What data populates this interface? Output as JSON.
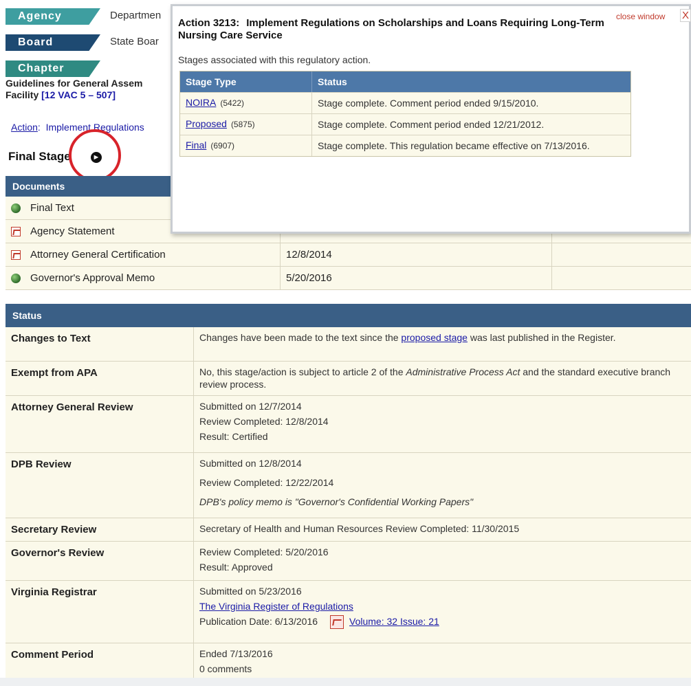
{
  "header": {
    "agency_tag": "Agency",
    "agency_text": "Departmen",
    "board_tag": "Board",
    "board_text": "State Boar",
    "chapter_tag": "Chapter",
    "chapter_title_line1": "Guidelines for General Assem",
    "chapter_title_line2_prefix": "Facility",
    "chapter_title_link": "[12 VAC 5 – 507]"
  },
  "action": {
    "label": "Action",
    "colon": ":",
    "title": "Implement Regulations"
  },
  "final_stage": {
    "label": "Final Stage",
    "icon": "arrow-circle-right-icon"
  },
  "documents": {
    "header": "Documents",
    "rows": [
      {
        "name": "Final Text",
        "icon": "globe-icon",
        "date": ""
      },
      {
        "name": "Agency Statement",
        "icon": "pdf-icon",
        "date": ""
      },
      {
        "name": "Attorney General Certification",
        "icon": "pdf-icon",
        "date": "12/8/2014"
      },
      {
        "name": "Governor's Approval Memo",
        "icon": "globe-icon",
        "date": "5/20/2016"
      }
    ]
  },
  "status": {
    "header": "Status",
    "changes_to_text": {
      "key": "Changes to Text",
      "pre": "Changes have been made to the text since the ",
      "link": "proposed stage",
      "post": " was last published in the Register."
    },
    "exempt": {
      "key": "Exempt from APA",
      "pre": "No, this stage/action is subject to article 2 of the ",
      "italic": "Administrative Process Act",
      "post": " and the standard executive branch review process."
    },
    "ag_review": {
      "key": "Attorney General Review",
      "l1": "Submitted on 12/7/2014",
      "l2": "Review Completed: 12/8/2014",
      "l3": "Result: Certified"
    },
    "dpb_review": {
      "key": "DPB Review",
      "l1": "Submitted on 12/8/2014",
      "l2": "Review Completed: 12/22/2014",
      "l3": "DPB's policy memo is \"Governor's Confidential Working Papers\""
    },
    "secretary_review": {
      "key": "Secretary Review",
      "l1": "Secretary of Health and Human Resources Review Completed: 11/30/2015"
    },
    "governor_review": {
      "key": "Governor's Review",
      "l1": "Review Completed: 5/20/2016",
      "l2": "Result: Approved"
    },
    "registrar": {
      "key": "Virginia Registrar",
      "l1": "Submitted on 5/23/2016",
      "link": "The Virginia Register of Regulations",
      "pub": "Publication Date: 6/13/2016",
      "volume_link": "Volume: 32  Issue: 21"
    },
    "comment_period": {
      "key": "Comment Period",
      "l1": "Ended 7/13/2016",
      "l2": "0 comments"
    }
  },
  "popup": {
    "action_no": "Action 3213:",
    "title": "Implement Regulations on Scholarships and Loans Requiring Long-Term Nursing Care Service",
    "close_label": "close window",
    "close_x": "X",
    "subtitle": "Stages associated with this regulatory action.",
    "col_stage": "Stage Type",
    "col_status": "Status",
    "stages": [
      {
        "type": "NOIRA",
        "num": "(5422)",
        "status": "Stage complete. Comment period ended 9/15/2010."
      },
      {
        "type": "Proposed",
        "num": "(5875)",
        "status": "Stage complete. Comment period ended 12/21/2012."
      },
      {
        "type": "Final",
        "num": "(6907)",
        "status": "Stage complete. This regulation became effective on 7/13/2016."
      }
    ]
  },
  "colors": {
    "header_blue": "#3a5f86",
    "agency_teal": "#3e9ea0",
    "board_navy": "#1e4a72",
    "row_cream": "#fbf9ea",
    "highlight_red": "#d8232a"
  }
}
